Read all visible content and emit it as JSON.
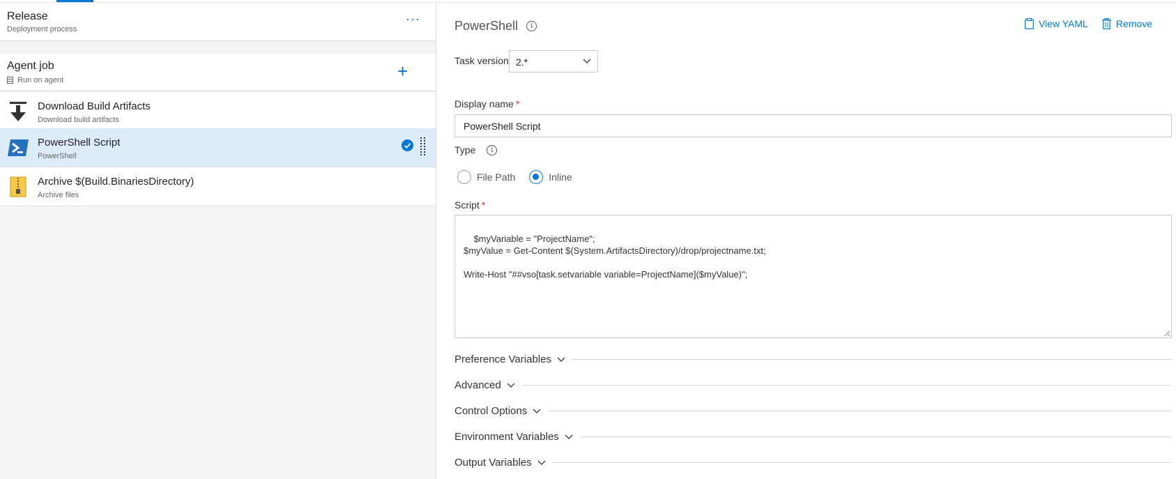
{
  "release": {
    "title": "Release",
    "subtitle": "Deployment process",
    "more_label": "···"
  },
  "agent_job": {
    "title": "Agent job",
    "subtitle": "Run on agent",
    "add_label": "+"
  },
  "tasks": [
    {
      "title": "Download Build Artifacts",
      "subtitle": "Download build artifacts",
      "icon": "download-arrow-icon",
      "selected": false
    },
    {
      "title": "PowerShell Script",
      "subtitle": "PowerShell",
      "icon": "powershell-icon",
      "selected": true
    },
    {
      "title": "Archive $(Build.BinariesDirectory)",
      "subtitle": "Archive files",
      "icon": "zip-archive-icon",
      "selected": false
    }
  ],
  "details": {
    "title": "PowerShell",
    "view_yaml_label": "View YAML",
    "remove_label": "Remove",
    "task_version_label": "Task version",
    "task_version_value": "2.*",
    "display_name_label": "Display name",
    "required_mark": "*",
    "display_name_value": "PowerShell Script",
    "type_label": "Type",
    "type_options": [
      "File Path",
      "Inline"
    ],
    "type_selected": "Inline",
    "script_label": "Script",
    "script_value": "$myVariable = \"ProjectName\";\n$myValue = Get-Content $(System.ArtifactsDirectory)/drop/projectname.txt;\n\nWrite-Host \"##vso[task.setvariable variable=ProjectName]($myValue)\";",
    "sections": [
      "Preference Variables",
      "Advanced",
      "Control Options",
      "Environment Variables",
      "Output Variables"
    ]
  },
  "colors": {
    "accent": "#0078d4",
    "selected_row": "#deecf9",
    "required": "#d13438"
  }
}
